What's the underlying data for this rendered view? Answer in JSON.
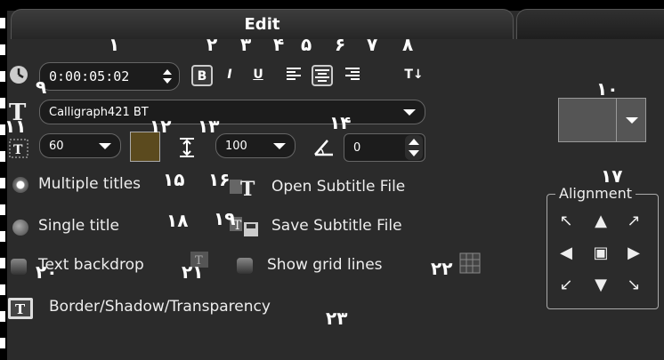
{
  "tabs": {
    "edit": "Edit"
  },
  "toolbar": {
    "timecode": "0:00:05:02",
    "bold": "B",
    "italic": "I",
    "underline": "U",
    "text_direction": "T↓"
  },
  "font": {
    "name": "Calligraph421 BT"
  },
  "size": {
    "value": "60"
  },
  "line_spacing": {
    "value": "100"
  },
  "rotation": {
    "value": "0"
  },
  "colors": {
    "text_color": "#5b4a1e",
    "preset_swatch": "#555555"
  },
  "options": {
    "multiple_titles": "Multiple titles",
    "single_title": "Single title",
    "text_backdrop": "Text backdrop",
    "show_grid_lines": "Show grid lines",
    "border_shadow": "Border/Shadow/Transparency",
    "open_subtitle": "Open Subtitle File",
    "save_subtitle": "Save Subtitle File"
  },
  "alignment": {
    "title": "Alignment"
  },
  "annotations": {
    "n1": "١",
    "n2": "٢",
    "n3": "٣",
    "n4": "۴",
    "n5": "۵",
    "n6": "۶",
    "n7": "٧",
    "n8": "٨",
    "n9": "٩",
    "n10": "١٠",
    "n11": "١١",
    "n12": "١٢",
    "n13": "١٣",
    "n14": "١۴",
    "n15": "١۵",
    "n16": "١۶",
    "n17": "١٧",
    "n18": "١٨",
    "n19": "١٩",
    "n20": "٢٠",
    "n21": "٢١",
    "n22": "٢٢",
    "n23": "٢٣"
  }
}
